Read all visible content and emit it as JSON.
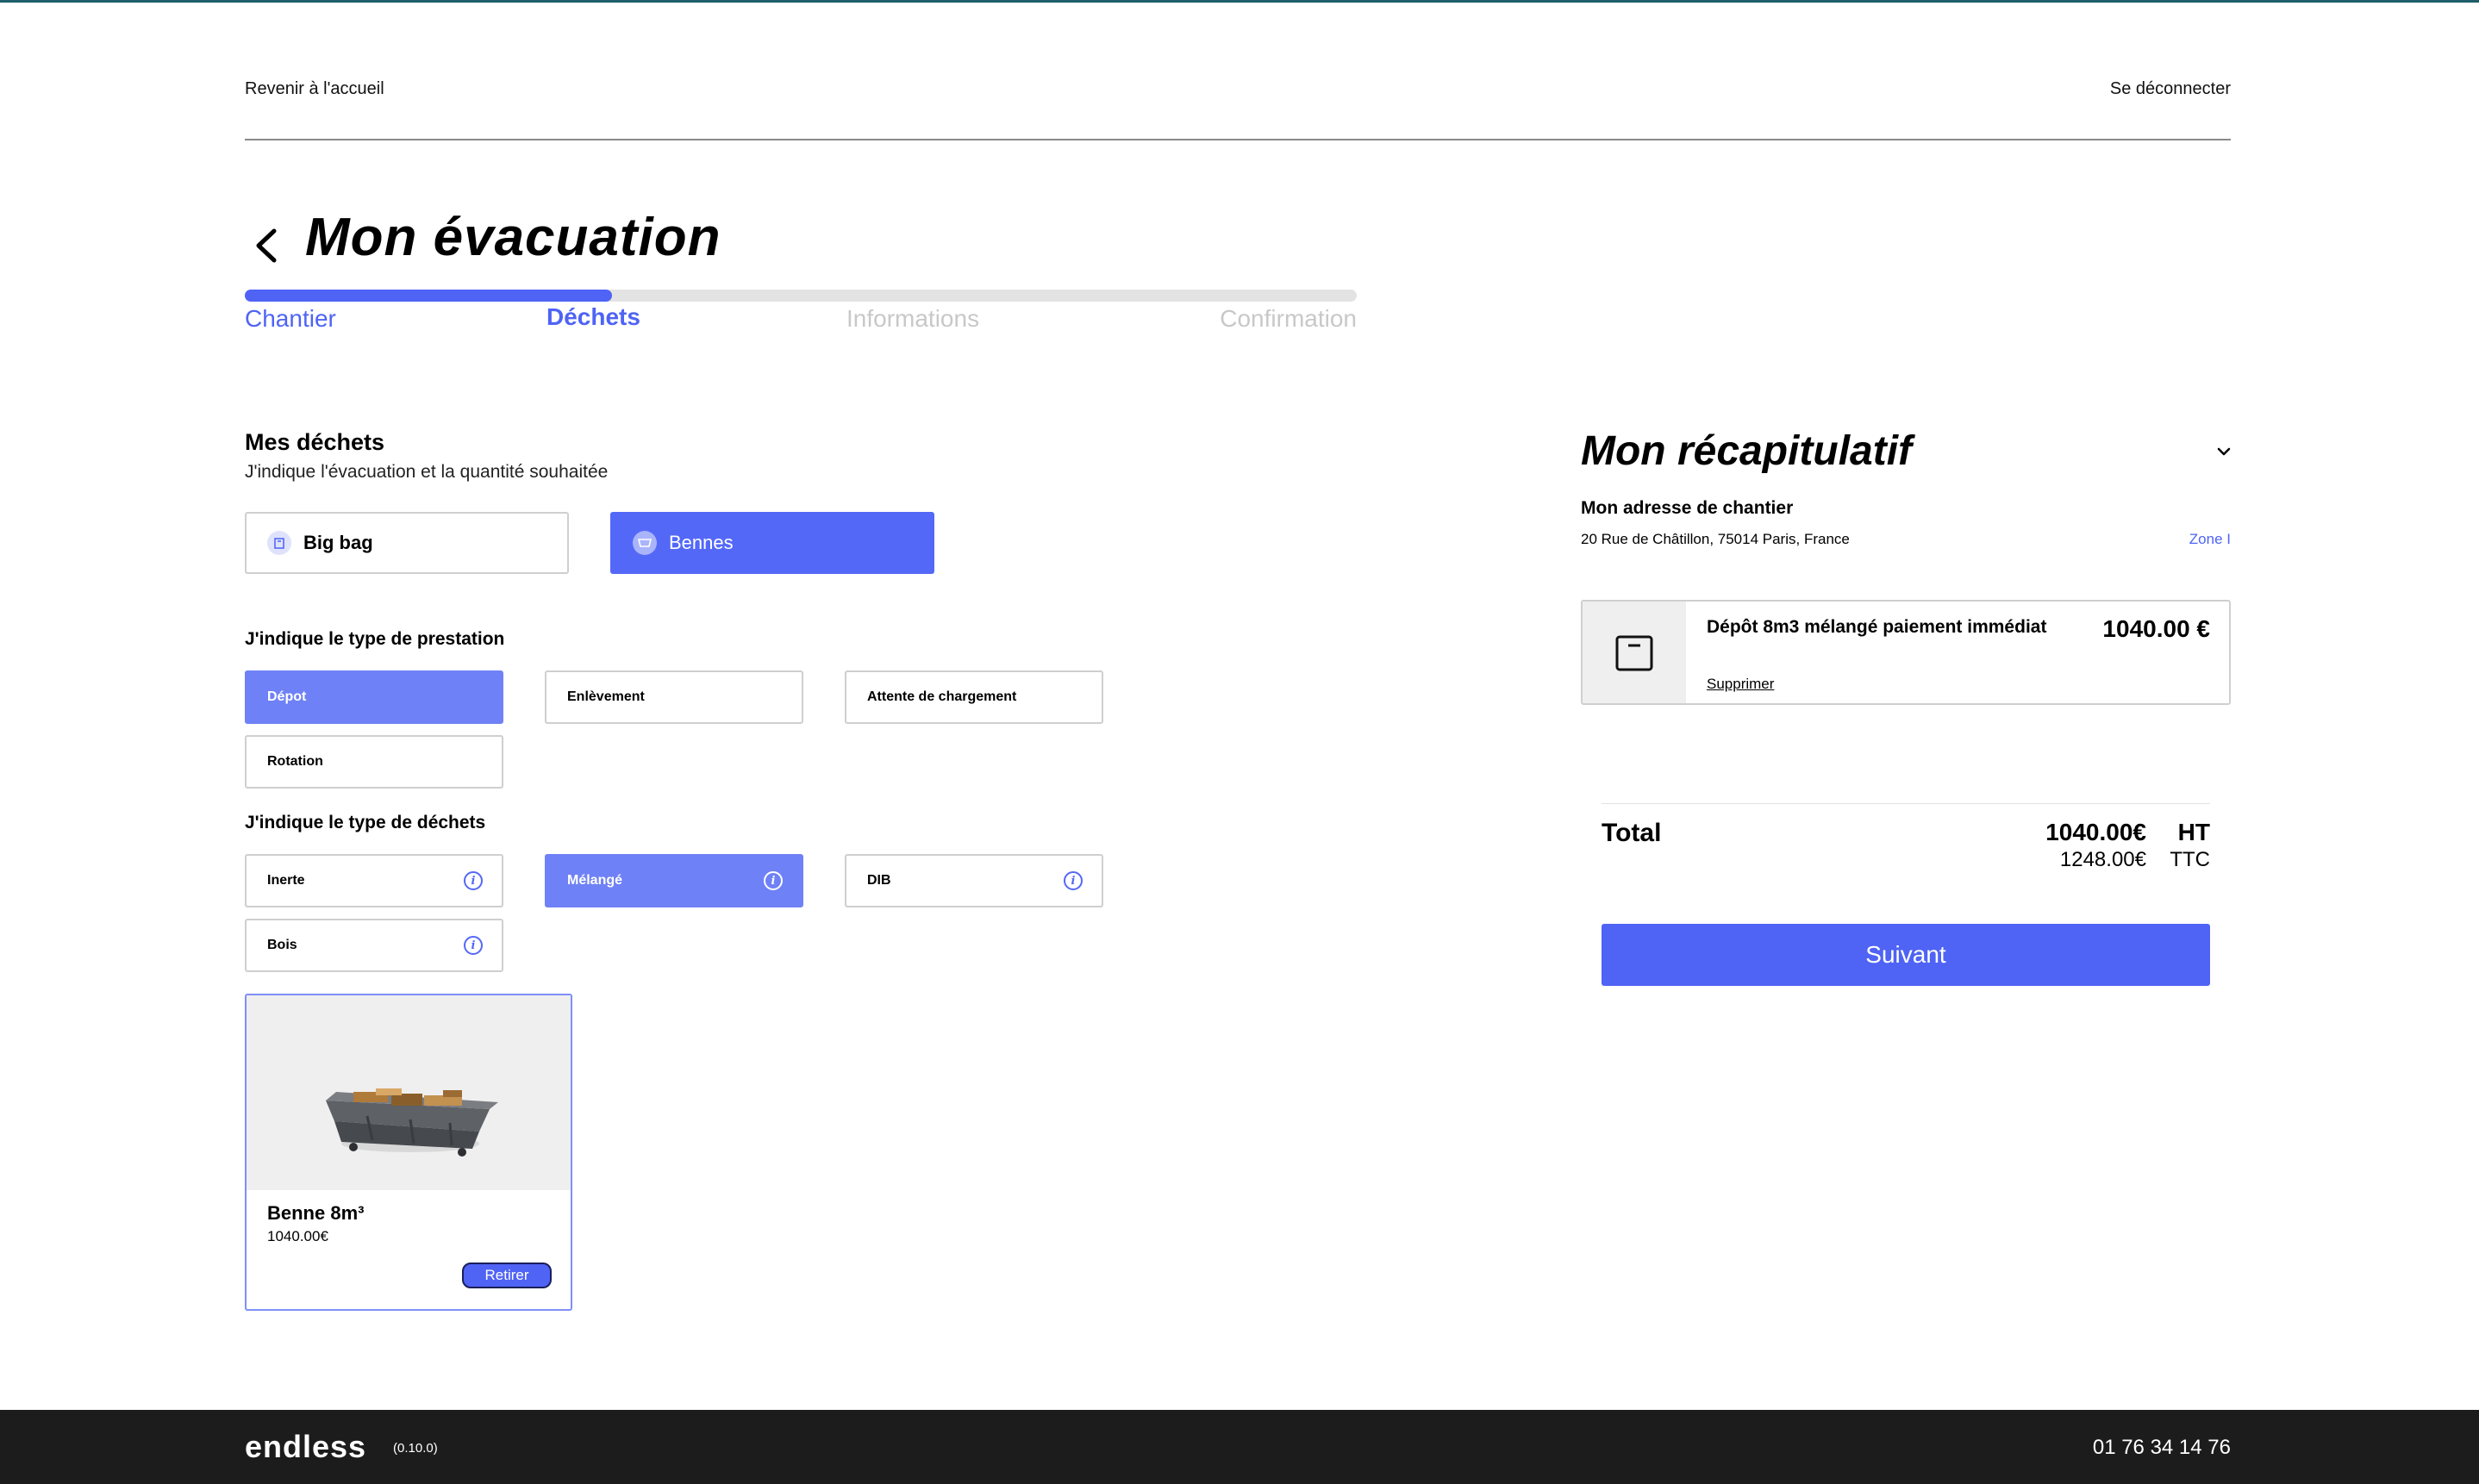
{
  "header": {
    "back_home": "Revenir à l'accueil",
    "logout": "Se déconnecter"
  },
  "page": {
    "title": "Mon évacuation",
    "progress_fraction": 0.33
  },
  "steps": [
    {
      "label": "Chantier",
      "state": "done"
    },
    {
      "label": "Déchets",
      "state": "current"
    },
    {
      "label": "Informations",
      "state": "todo"
    },
    {
      "label": "Confirmation",
      "state": "todo"
    }
  ],
  "waste": {
    "title": "Mes déchets",
    "subtitle": "J'indique l'évacuation et la quantité souhaitée",
    "containers": [
      {
        "label": "Big bag",
        "icon": "bag-icon",
        "selected": false
      },
      {
        "label": "Bennes",
        "icon": "dumpster-icon",
        "selected": true
      }
    ],
    "service_title": "J'indique le type de prestation",
    "services": [
      {
        "label": "Dépot",
        "selected": true
      },
      {
        "label": "Enlèvement",
        "selected": false
      },
      {
        "label": "Attente de chargement",
        "selected": false
      },
      {
        "label": "Rotation",
        "selected": false
      }
    ],
    "type_title": "J'indique le type de déchets",
    "types": [
      {
        "label": "Inerte",
        "selected": false
      },
      {
        "label": "Mélangé",
        "selected": true
      },
      {
        "label": "DIB",
        "selected": false
      },
      {
        "label": "Bois",
        "selected": false
      }
    ],
    "info_glyph": "i"
  },
  "product": {
    "name": "Benne 8m³",
    "price": "1040.00€",
    "remove_label": "Retirer",
    "image_icon": "dumpster-image"
  },
  "recap": {
    "title": "Mon récapitulatif",
    "address_label": "Mon adresse de chantier",
    "address": "20 Rue de Châtillon, 75014 Paris, France",
    "zone": "Zone I",
    "item": {
      "name": "Dépôt 8m3 mélangé paiement immédiat",
      "price": "1040.00 €",
      "remove": "Supprimer",
      "icon": "bag-icon"
    },
    "total_label": "Total",
    "total_ht": "1040.00€",
    "ht_label": "HT",
    "total_ttc": "1248.00€",
    "ttc_label": "TTC",
    "next_button": "Suivant"
  },
  "footer": {
    "brand": "endless",
    "version": "(0.10.0)",
    "phone": "01 76 34 14 76"
  },
  "colors": {
    "accent": "#4f63f5",
    "accent_light": "#6f81f6",
    "footer_bg": "#1c1c1c"
  }
}
